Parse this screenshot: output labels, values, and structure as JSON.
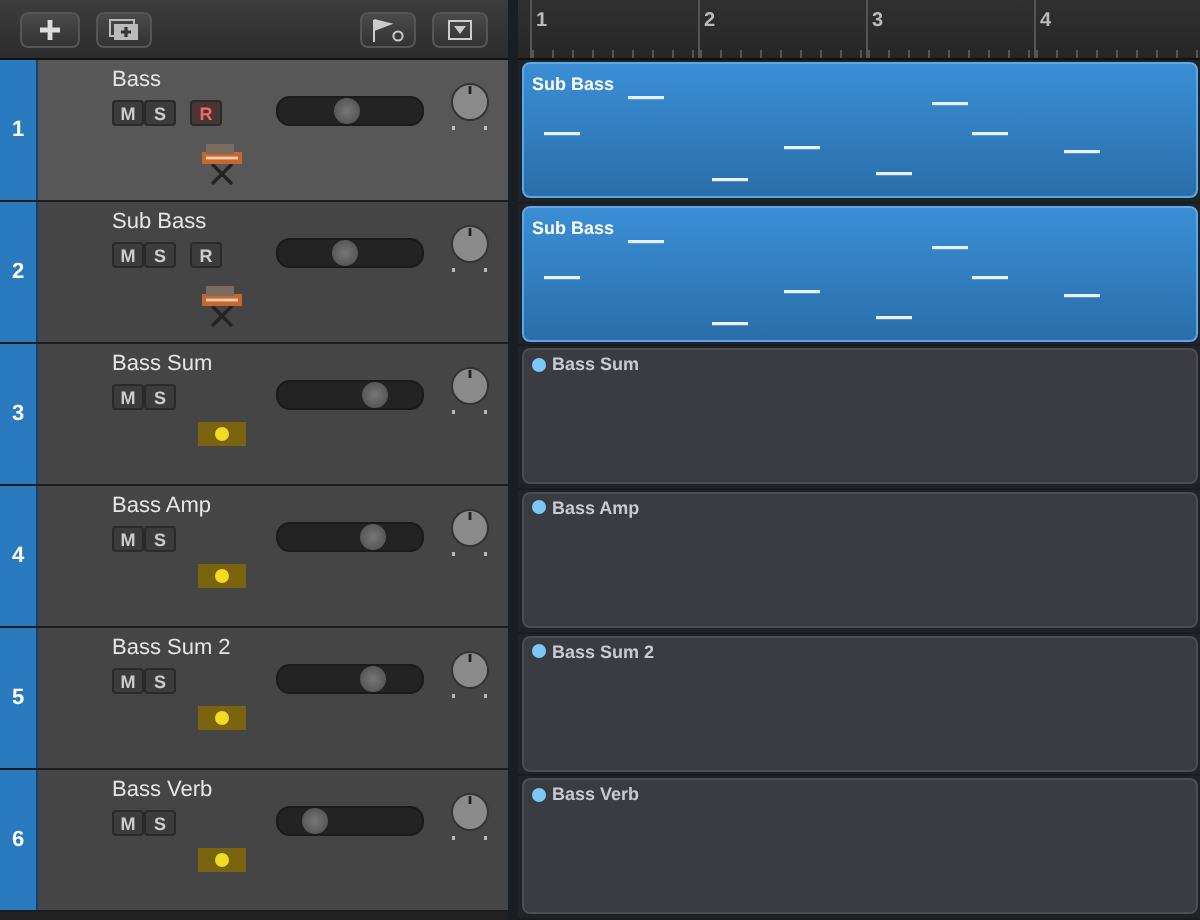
{
  "ruler": {
    "bars": [
      "1",
      "2",
      "3",
      "4"
    ]
  },
  "tracks": [
    {
      "number": "1",
      "name": "Bass",
      "kind": "instrument",
      "selected": true,
      "level": 0.49,
      "region": "Sub Bass",
      "buttons": [
        {
          "label": "M",
          "kind": "mute"
        },
        {
          "label": "S",
          "kind": "solo"
        },
        {
          "label": "R",
          "kind": "record",
          "armed": true
        }
      ]
    },
    {
      "number": "2",
      "name": "Sub Bass",
      "kind": "instrument",
      "selected": false,
      "level": 0.47,
      "region": "Sub Bass",
      "buttons": [
        {
          "label": "M",
          "kind": "mute"
        },
        {
          "label": "S",
          "kind": "solo"
        },
        {
          "label": "R",
          "kind": "record",
          "armed": false
        }
      ]
    },
    {
      "number": "3",
      "name": "Bass Sum",
      "kind": "audio",
      "selected": false,
      "level": 0.72,
      "region": "Bass Sum",
      "buttons": [
        {
          "label": "M",
          "kind": "mute"
        },
        {
          "label": "S",
          "kind": "solo"
        }
      ]
    },
    {
      "number": "4",
      "name": "Bass Amp",
      "kind": "audio",
      "selected": false,
      "level": 0.71,
      "region": "Bass Amp",
      "buttons": [
        {
          "label": "M",
          "kind": "mute"
        },
        {
          "label": "S",
          "kind": "solo"
        }
      ]
    },
    {
      "number": "5",
      "name": "Bass Sum 2",
      "kind": "audio",
      "selected": false,
      "level": 0.71,
      "region": "Bass Sum 2",
      "buttons": [
        {
          "label": "M",
          "kind": "mute"
        },
        {
          "label": "S",
          "kind": "solo"
        }
      ]
    },
    {
      "number": "6",
      "name": "Bass Verb",
      "kind": "audio",
      "selected": false,
      "level": 0.2,
      "region": "Bass Verb",
      "buttons": [
        {
          "label": "M",
          "kind": "mute"
        },
        {
          "label": "S",
          "kind": "solo"
        }
      ]
    }
  ]
}
